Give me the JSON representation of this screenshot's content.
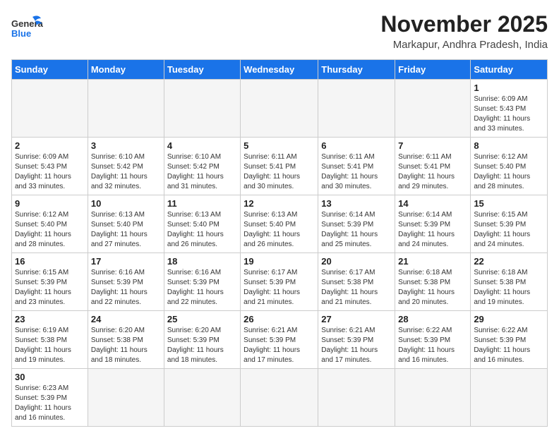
{
  "header": {
    "logo_general": "General",
    "logo_blue": "Blue",
    "month_year": "November 2025",
    "location": "Markapur, Andhra Pradesh, India"
  },
  "weekdays": [
    "Sunday",
    "Monday",
    "Tuesday",
    "Wednesday",
    "Thursday",
    "Friday",
    "Saturday"
  ],
  "weeks": [
    [
      {
        "day": "",
        "info": ""
      },
      {
        "day": "",
        "info": ""
      },
      {
        "day": "",
        "info": ""
      },
      {
        "day": "",
        "info": ""
      },
      {
        "day": "",
        "info": ""
      },
      {
        "day": "",
        "info": ""
      },
      {
        "day": "1",
        "info": "Sunrise: 6:09 AM\nSunset: 5:43 PM\nDaylight: 11 hours\nand 33 minutes."
      }
    ],
    [
      {
        "day": "2",
        "info": "Sunrise: 6:09 AM\nSunset: 5:43 PM\nDaylight: 11 hours\nand 33 minutes."
      },
      {
        "day": "3",
        "info": "Sunrise: 6:10 AM\nSunset: 5:42 PM\nDaylight: 11 hours\nand 32 minutes."
      },
      {
        "day": "4",
        "info": "Sunrise: 6:10 AM\nSunset: 5:42 PM\nDaylight: 11 hours\nand 31 minutes."
      },
      {
        "day": "5",
        "info": "Sunrise: 6:11 AM\nSunset: 5:41 PM\nDaylight: 11 hours\nand 30 minutes."
      },
      {
        "day": "6",
        "info": "Sunrise: 6:11 AM\nSunset: 5:41 PM\nDaylight: 11 hours\nand 30 minutes."
      },
      {
        "day": "7",
        "info": "Sunrise: 6:11 AM\nSunset: 5:41 PM\nDaylight: 11 hours\nand 29 minutes."
      },
      {
        "day": "8",
        "info": "Sunrise: 6:12 AM\nSunset: 5:40 PM\nDaylight: 11 hours\nand 28 minutes."
      }
    ],
    [
      {
        "day": "9",
        "info": "Sunrise: 6:12 AM\nSunset: 5:40 PM\nDaylight: 11 hours\nand 28 minutes."
      },
      {
        "day": "10",
        "info": "Sunrise: 6:13 AM\nSunset: 5:40 PM\nDaylight: 11 hours\nand 27 minutes."
      },
      {
        "day": "11",
        "info": "Sunrise: 6:13 AM\nSunset: 5:40 PM\nDaylight: 11 hours\nand 26 minutes."
      },
      {
        "day": "12",
        "info": "Sunrise: 6:13 AM\nSunset: 5:40 PM\nDaylight: 11 hours\nand 26 minutes."
      },
      {
        "day": "13",
        "info": "Sunrise: 6:14 AM\nSunset: 5:39 PM\nDaylight: 11 hours\nand 25 minutes."
      },
      {
        "day": "14",
        "info": "Sunrise: 6:14 AM\nSunset: 5:39 PM\nDaylight: 11 hours\nand 24 minutes."
      },
      {
        "day": "15",
        "info": "Sunrise: 6:15 AM\nSunset: 5:39 PM\nDaylight: 11 hours\nand 24 minutes."
      }
    ],
    [
      {
        "day": "16",
        "info": "Sunrise: 6:15 AM\nSunset: 5:39 PM\nDaylight: 11 hours\nand 23 minutes."
      },
      {
        "day": "17",
        "info": "Sunrise: 6:16 AM\nSunset: 5:39 PM\nDaylight: 11 hours\nand 22 minutes."
      },
      {
        "day": "18",
        "info": "Sunrise: 6:16 AM\nSunset: 5:39 PM\nDaylight: 11 hours\nand 22 minutes."
      },
      {
        "day": "19",
        "info": "Sunrise: 6:17 AM\nSunset: 5:39 PM\nDaylight: 11 hours\nand 21 minutes."
      },
      {
        "day": "20",
        "info": "Sunrise: 6:17 AM\nSunset: 5:38 PM\nDaylight: 11 hours\nand 21 minutes."
      },
      {
        "day": "21",
        "info": "Sunrise: 6:18 AM\nSunset: 5:38 PM\nDaylight: 11 hours\nand 20 minutes."
      },
      {
        "day": "22",
        "info": "Sunrise: 6:18 AM\nSunset: 5:38 PM\nDaylight: 11 hours\nand 19 minutes."
      }
    ],
    [
      {
        "day": "23",
        "info": "Sunrise: 6:19 AM\nSunset: 5:38 PM\nDaylight: 11 hours\nand 19 minutes."
      },
      {
        "day": "24",
        "info": "Sunrise: 6:20 AM\nSunset: 5:38 PM\nDaylight: 11 hours\nand 18 minutes."
      },
      {
        "day": "25",
        "info": "Sunrise: 6:20 AM\nSunset: 5:39 PM\nDaylight: 11 hours\nand 18 minutes."
      },
      {
        "day": "26",
        "info": "Sunrise: 6:21 AM\nSunset: 5:39 PM\nDaylight: 11 hours\nand 17 minutes."
      },
      {
        "day": "27",
        "info": "Sunrise: 6:21 AM\nSunset: 5:39 PM\nDaylight: 11 hours\nand 17 minutes."
      },
      {
        "day": "28",
        "info": "Sunrise: 6:22 AM\nSunset: 5:39 PM\nDaylight: 11 hours\nand 16 minutes."
      },
      {
        "day": "29",
        "info": "Sunrise: 6:22 AM\nSunset: 5:39 PM\nDaylight: 11 hours\nand 16 minutes."
      }
    ],
    [
      {
        "day": "30",
        "info": "Sunrise: 6:23 AM\nSunset: 5:39 PM\nDaylight: 11 hours\nand 16 minutes."
      },
      {
        "day": "",
        "info": ""
      },
      {
        "day": "",
        "info": ""
      },
      {
        "day": "",
        "info": ""
      },
      {
        "day": "",
        "info": ""
      },
      {
        "day": "",
        "info": ""
      },
      {
        "day": "",
        "info": ""
      }
    ]
  ]
}
